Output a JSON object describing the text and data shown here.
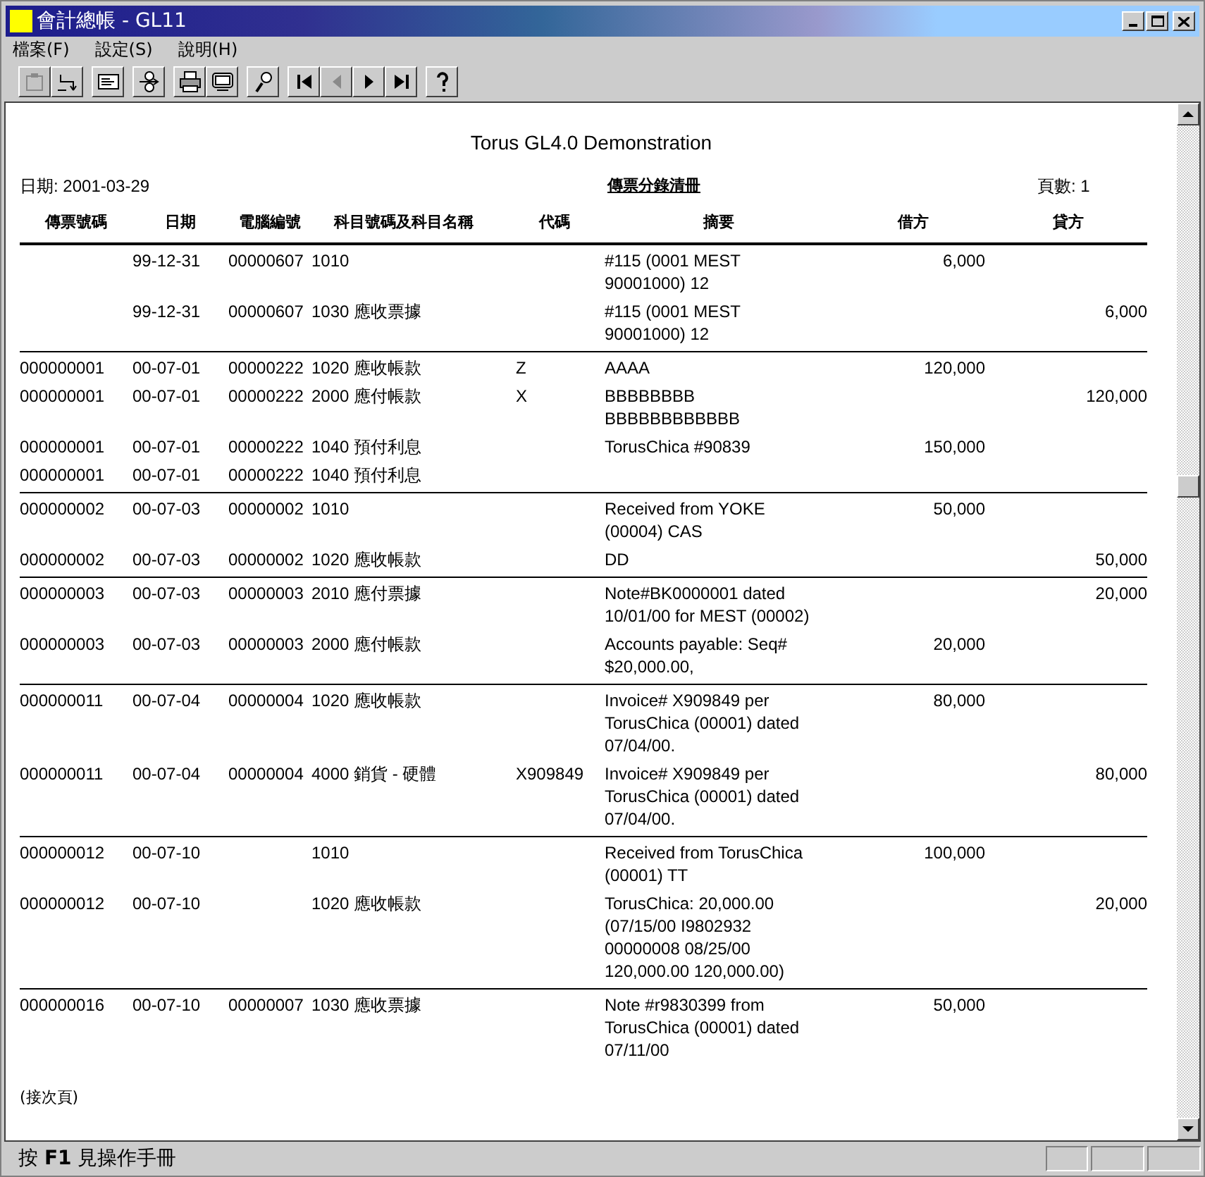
{
  "window": {
    "title": "會計總帳 - GL11"
  },
  "menu": [
    "檔案(F)",
    "設定(S)",
    "說明(H)"
  ],
  "toolbar": [
    {
      "kind": "clipboard",
      "disabled": true
    },
    {
      "kind": "return",
      "disabled": false
    },
    {
      "kind": "form",
      "disabled": false
    },
    {
      "kind": "switch",
      "disabled": false
    },
    {
      "kind": "printer",
      "disabled": false
    },
    {
      "kind": "screen",
      "disabled": false
    },
    {
      "kind": "zoom",
      "disabled": false
    },
    {
      "kind": "first",
      "disabled": false
    },
    {
      "kind": "prev",
      "disabled": true
    },
    {
      "kind": "next",
      "disabled": false
    },
    {
      "kind": "last",
      "disabled": false
    },
    {
      "kind": "help",
      "disabled": false
    }
  ],
  "report": {
    "title": "Torus GL4.0 Demonstration",
    "date": "日期: 2001-03-29",
    "heading": "傳票分錄清冊",
    "page": "頁數: 1",
    "columns": [
      "傳票號碼",
      "日期",
      "電腦編號",
      "科目號碼及科目名稱",
      "代碼",
      "摘要",
      "借方",
      "貸方"
    ],
    "groups": [
      [
        {
          "date": "99-12-31",
          "entry": "00000607",
          "account": "1010",
          "memo": [
            "#115 (0001 MEST",
            "90001000) 12"
          ],
          "debit": "6,000"
        },
        {
          "date": "99-12-31",
          "entry": "00000607",
          "account": "1030 應收票據",
          "memo": [
            "#115 (0001 MEST",
            "90001000) 12"
          ],
          "credit": "6,000"
        }
      ],
      [
        {
          "voucher": "000000001",
          "date": "00-07-01",
          "entry": "00000222",
          "account": "1020 應收帳款",
          "code": "Z",
          "memo": [
            "AAAA"
          ],
          "debit": "120,000"
        },
        {
          "voucher": "000000001",
          "date": "00-07-01",
          "entry": "00000222",
          "account": "2000 應付帳款",
          "code": "X",
          "memo": [
            "BBBBBBBB",
            "BBBBBBBBBBBB"
          ],
          "credit": "120,000"
        },
        {
          "voucher": "000000001",
          "date": "00-07-01",
          "entry": "00000222",
          "account": "1040 預付利息",
          "memo": [
            "TorusChica #90839"
          ],
          "debit": "150,000"
        },
        {
          "voucher": "000000001",
          "date": "00-07-01",
          "entry": "00000222",
          "account": "1040 預付利息"
        }
      ],
      [
        {
          "voucher": "000000002",
          "date": "00-07-03",
          "entry": "00000002",
          "account": "1010",
          "memo": [
            "Received from YOKE",
            "(00004) CAS"
          ],
          "debit": "50,000"
        },
        {
          "voucher": "000000002",
          "date": "00-07-03",
          "entry": "00000002",
          "account": "1020 應收帳款",
          "memo": [
            "DD"
          ],
          "credit": "50,000"
        }
      ],
      [
        {
          "voucher": "000000003",
          "date": "00-07-03",
          "entry": "00000003",
          "account": "2010 應付票據",
          "memo": [
            "Note#BK0000001 dated",
            "10/01/00 for MEST (00002)"
          ],
          "credit": "20,000"
        },
        {
          "voucher": "000000003",
          "date": "00-07-03",
          "entry": "00000003",
          "account": "2000 應付帳款",
          "memo": [
            "Accounts payable: Seq#",
            "$20,000.00,"
          ],
          "debit": "20,000"
        }
      ],
      [
        {
          "voucher": "000000011",
          "date": "00-07-04",
          "entry": "00000004",
          "account": "1020 應收帳款",
          "memo": [
            "Invoice# X909849 per",
            "TorusChica (00001) dated",
            "07/04/00."
          ],
          "debit": "80,000"
        },
        {
          "voucher": "000000011",
          "date": "00-07-04",
          "entry": "00000004",
          "account": "4000 銷貨 - 硬體",
          "code": "X909849",
          "memo": [
            "Invoice# X909849 per",
            "TorusChica (00001) dated",
            "07/04/00."
          ],
          "credit": "80,000"
        }
      ],
      [
        {
          "voucher": "000000012",
          "date": "00-07-10",
          "account": "1010",
          "memo": [
            "Received from TorusChica",
            "(00001) TT"
          ],
          "debit": "100,000"
        },
        {
          "voucher": "000000012",
          "date": "00-07-10",
          "account": "1020 應收帳款",
          "memo": [
            "TorusChica: 20,000.00",
            "(07/15/00 I9802932",
            "00000008 08/25/00",
            "120,000.00 120,000.00)"
          ],
          "credit": "20,000"
        }
      ],
      [
        {
          "voucher": "000000016",
          "date": "00-07-10",
          "entry": "00000007",
          "account": "1030 應收票據",
          "memo": [
            "Note #r9830399 from",
            "TorusChica (00001) dated",
            "07/11/00"
          ],
          "debit": "50,000"
        }
      ]
    ],
    "footer": "(接次頁)"
  },
  "status_bar": {
    "text": "按 **F1** 見操作手冊"
  }
}
